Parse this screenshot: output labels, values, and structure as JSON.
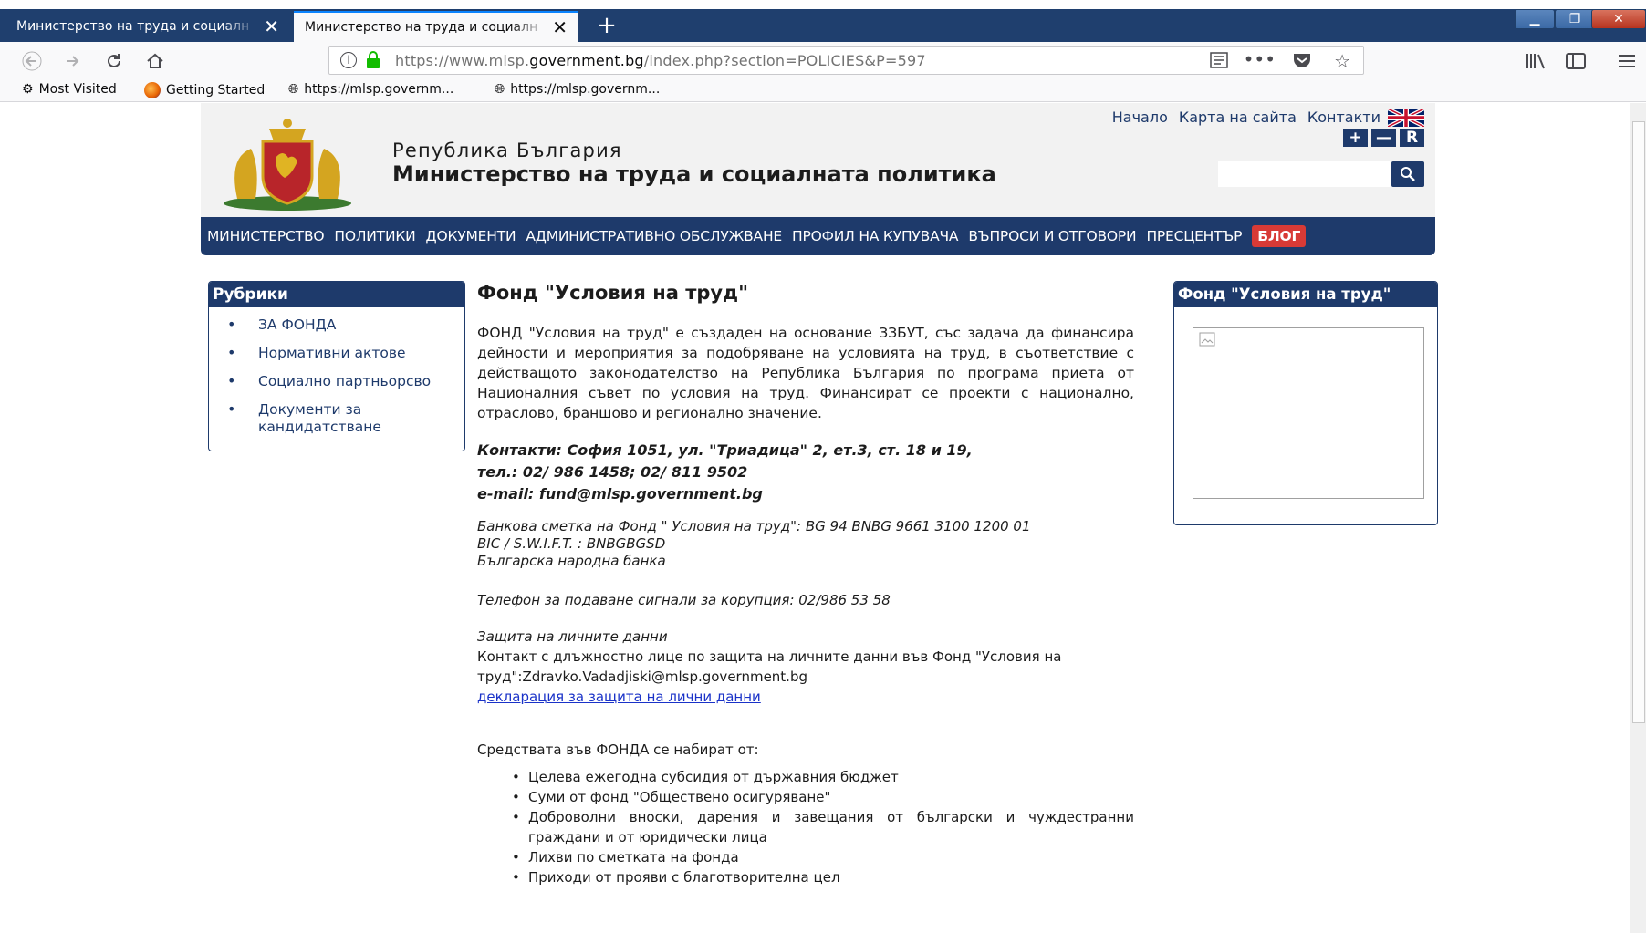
{
  "browser": {
    "tabs": [
      {
        "label": "Министерство на труда и социалн",
        "active": false
      },
      {
        "label": "Министерство на труда и социалн",
        "active": true
      }
    ],
    "url_prefix": "https://www.mlsp.",
    "url_domain": "government.bg",
    "url_suffix": "/index.php?section=POLICIES&P=597",
    "bookmarks": [
      "Most Visited",
      "Getting Started",
      "https://mlsp.governm...",
      "https://mlsp.governm..."
    ]
  },
  "header": {
    "republic": "Република България",
    "ministry": "Министерство на труда и социалната политика",
    "links": [
      "Начало",
      "Карта на сайта",
      "Контакти"
    ],
    "font_buttons": [
      "+",
      "—",
      "R"
    ]
  },
  "nav": {
    "items": [
      "МИНИСТЕРСТВО",
      "ПОЛИТИКИ",
      "ДОКУМЕНТИ",
      "АДМИНИСТРАТИВНО ОБСЛУЖВАНЕ",
      "ПРОФИЛ НА КУПУВАЧА",
      "ВЪПРОСИ И ОТГОВОРИ",
      "ПРЕСЦЕНТЪР"
    ],
    "blog": "БЛОГ"
  },
  "sidebar": {
    "title": "Рубрики",
    "items": [
      "ЗА ФОНДА",
      "Нормативни актове",
      "Социално партньорсво",
      "Документи за кандидатстване"
    ]
  },
  "content": {
    "title": "Фонд \"Условия на труд\"",
    "intro": "ФОНД \"Условия на труд\" е създаден на основание ЗЗБУТ, със задача да финансира дейности и мероприятия за подобряване на условията на труд, в съответствие с действащото законодателство на Република България по програма приета от Националния съвет по условия на труд. Финансират се проекти с национално, отраслово, браншово и регионално значение.",
    "contact_address": "Контакти: София 1051, ул. \"Триадица\" 2, ет.3, ст. 18 и 19,",
    "contact_phone": "тел.: 02/ 986 1458; 02/ 811 9502",
    "contact_email": "e-mail: fund@mlsp.government.bg",
    "bank_account": "Банкова сметка на Фонд \" Условия на труд\": BG 94 BNBG 9661 3100 1200 01",
    "bic": "BIC / S.W.I.F.T. : BNBGBGSD",
    "bank_name": "Българска народна банка",
    "corruption_phone": "Телефон за подаване сигнали за корупция: 02/986 53 58",
    "privacy_title": "Защита на личните данни",
    "privacy_text": "Контакт с длъжностно лице по защита на личните данни във Фонд \"Условия на труд\":Zdravko.Vadadjiski@mlsp.government.bg",
    "privacy_link": "декларация за защита на лични данни",
    "funds_intro": "Средствата във ФОНДА се набират от:",
    "funds_list": [
      "Целева ежегодна субсидия от държавния бюджет",
      "Суми от фонд \"Обществено осигуряване\"",
      "Доброволни вноски, дарения и завещания от български и чуждестранни граждани и от юридически лица",
      "Лихви по сметката на фонда",
      "Приходи от прояви с благотворителна цел"
    ]
  },
  "right_box": {
    "title": "Фонд \"Условия на труд\""
  },
  "colors": {
    "brand_navy": "#1e3a6b",
    "blog_red": "#d83a36",
    "link_blue": "#1a32c8"
  }
}
